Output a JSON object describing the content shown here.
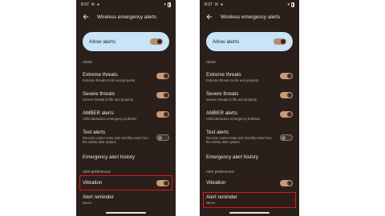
{
  "screens": [
    {
      "status_time": "8:37",
      "app_title": "Wireless emergency alerts",
      "allow_alerts_label": "Allow alerts",
      "allow_alerts_on": true,
      "alerts_header": "Alerts",
      "extreme_title": "Extreme threats",
      "extreme_sub": "Extreme threats to life and property",
      "extreme_on": true,
      "severe_title": "Severe threats",
      "severe_sub": "Severe threats to life and property",
      "severe_on": true,
      "amber_title": "AMBER alerts",
      "amber_sub": "Child abduction emergency bulletins",
      "amber_on": true,
      "test_title": "Test alerts",
      "test_sub_1": "Receive carrier tests and monthly tests from",
      "test_sub_2": "the safety alert system",
      "test_on": false,
      "history_title": "Emergency alert history",
      "prefs_header": "Alert preferences",
      "vibration_title": "Vibration",
      "vibration_on": true,
      "reminder_title": "Alert reminder",
      "reminder_sub": "Never",
      "highlighted_item": "Vibration"
    },
    {
      "status_time": "8:37",
      "app_title": "Wireless emergency alerts",
      "allow_alerts_label": "Allow alerts",
      "allow_alerts_on": true,
      "alerts_header": "Alerts",
      "extreme_title": "Extreme threats",
      "extreme_sub": "Extreme threats to life and property",
      "extreme_on": true,
      "severe_title": "Severe threats",
      "severe_sub": "Severe threats to life and property",
      "severe_on": true,
      "amber_title": "AMBER alerts",
      "amber_sub": "Child abduction emergency bulletins",
      "amber_on": true,
      "test_title": "Test alerts",
      "test_sub_1": "Receive carrier tests and monthly tests from",
      "test_sub_2": "the safety alert system",
      "test_on": false,
      "history_title": "Emergency alert history",
      "prefs_header": "Alert preferences",
      "vibration_title": "Vibration",
      "vibration_on": true,
      "reminder_title": "Alert reminder",
      "reminder_sub": "Never",
      "highlighted_item": "Alert reminder"
    }
  ],
  "colors": {
    "background": "#2a1f1b",
    "card": "#c8e4f7",
    "toggle_on_track": "#c89a78",
    "highlight": "#e0151b"
  }
}
